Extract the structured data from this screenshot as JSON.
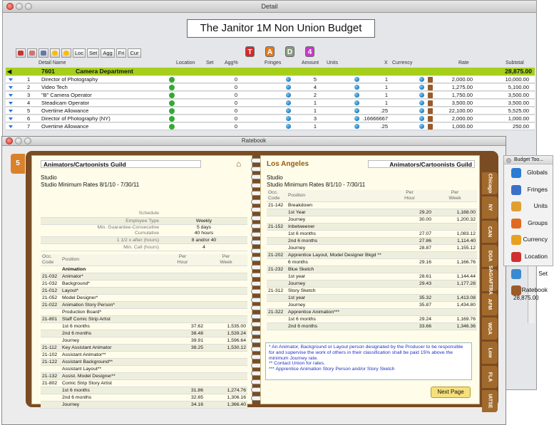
{
  "detail": {
    "window_title": "Detail",
    "budget_title": "The Janitor 1M Non Union Budget",
    "toolbar": [
      "Loc",
      "Set",
      "Agg",
      "Fri",
      "Cur"
    ],
    "letter_icons": [
      {
        "l": "T",
        "c": "#d62a2a"
      },
      {
        "l": "A",
        "c": "#e47b22"
      },
      {
        "l": "D",
        "c": "#8a9a83"
      },
      {
        "l": "4",
        "c": "#c83ac9"
      }
    ],
    "columns": {
      "detail_name": "Detail Name",
      "location": "Location",
      "set": "Set",
      "agg": "Agg%",
      "fringes": "Fringes",
      "amount": "Amount",
      "units": "Units",
      "x": "X",
      "currency": "Currency",
      "rate": "Rate",
      "subtotal": "Subtotal"
    },
    "dept": {
      "code": "7601",
      "name": "Camera Department",
      "subtotal": "28,875.00"
    },
    "rows": [
      {
        "n": "1",
        "name": "Director of Photography",
        "agg": "0",
        "amount": "5",
        "x": "1",
        "rate": "2,000.00",
        "sub": "10,000.00"
      },
      {
        "n": "2",
        "name": "Video Tech",
        "agg": "0",
        "amount": "4",
        "x": "1",
        "rate": "1,275.00",
        "sub": "5,100.00"
      },
      {
        "n": "3",
        "name": "\"B\" Camera Operator",
        "agg": "0",
        "amount": "2",
        "x": "1",
        "rate": "1,750.00",
        "sub": "3,500.00"
      },
      {
        "n": "4",
        "name": "Steadicam Operator",
        "agg": "0",
        "amount": "1",
        "x": "1",
        "rate": "3,500.00",
        "sub": "3,500.00"
      },
      {
        "n": "5",
        "name": "Overtime Allowance",
        "agg": "0",
        "amount": "1",
        "x": ".25",
        "rate": "22,100.00",
        "sub": "5,525.00"
      },
      {
        "n": "6",
        "name": "Director of Photography (NY)",
        "agg": "0",
        "amount": "3",
        "x": ".16666667",
        "rate": "2,000.00",
        "sub": "1,000.00"
      },
      {
        "n": "7",
        "name": "Overtime Allowance",
        "agg": "0",
        "amount": "1",
        "x": ".25",
        "rate": "1,000.00",
        "sub": "250.00"
      }
    ],
    "bottom_total": "28,875.00"
  },
  "ratebook": {
    "window_title": "Ratebook",
    "side_tab": "5",
    "left": {
      "guild": "Animators/Cartoonists Guild",
      "studio": "Studio",
      "rates_title": "Studio Minimum Rates 8/1/10 - 7/30/11",
      "info": [
        {
          "k": "Schedule",
          "v": ""
        },
        {
          "k": "Employee Type",
          "v": "Weekly"
        },
        {
          "k": "Min. Guarantee-Consecutive\nCumulative",
          "v": "5 days\n40 hours"
        },
        {
          "k": "1 1/2 x after (hours)",
          "v": "8 and/or 40"
        },
        {
          "k": "Min. Call (hours)",
          "v": "4"
        }
      ],
      "hdr": {
        "occ": "Occ.\nCode",
        "pos": "Position",
        "hour": "Per\nHour",
        "week": "Per\nWeek"
      },
      "rows": [
        [
          "",
          "Animation",
          "",
          ""
        ],
        [
          "21-032",
          "Animator*",
          "",
          ""
        ],
        [
          "21-032",
          "Background*",
          "",
          ""
        ],
        [
          "21-012",
          "Layout*",
          "",
          ""
        ],
        [
          "21-052",
          "Model Designer*",
          "",
          ""
        ],
        [
          "21-022",
          "Animation Story Person*",
          "",
          ""
        ],
        [
          "",
          "Production Board*",
          "",
          ""
        ],
        [
          "21-801",
          "Staff Comic Strip Artist",
          "",
          ""
        ],
        [
          "",
          "1st 6 months",
          "37.62",
          "1,535.00"
        ],
        [
          "",
          "2nd 6 months",
          "38.48",
          "1,539.24"
        ],
        [
          "",
          "Journey",
          "39.91",
          "1,596.64"
        ],
        [
          "21-112",
          "Key Assistant Animator",
          "38.25",
          "1,530.12"
        ],
        [
          "21-102",
          "Assistant Animator**",
          "",
          ""
        ],
        [
          "21-122",
          "Assistant Background**",
          "",
          ""
        ],
        [
          "",
          "Assistant Layout**",
          "",
          ""
        ],
        [
          "21-132",
          "Assist. Model Designer**",
          "",
          ""
        ],
        [
          "21-802",
          "Comic Strip Story Artist",
          "",
          ""
        ],
        [
          "",
          "1st 6 months",
          "31.86",
          "1,274.76"
        ],
        [
          "",
          "2nd 6 months",
          "32.65",
          "1,306.16"
        ],
        [
          "",
          "Journey",
          "34.16",
          "1,366.40"
        ]
      ]
    },
    "right": {
      "city": "Los Angeles",
      "guild": "Animators/Cartoonists Guild",
      "studio": "Studio",
      "rates_title": "Studio Minimum Rates 8/1/10 - 7/30/11",
      "hdr": {
        "occ": "Occ.\nCode",
        "pos": "Position",
        "hour": "Per\nHour",
        "week": "Per\nWeek"
      },
      "rows": [
        [
          "21-142",
          "Breakdown",
          "",
          ""
        ],
        [
          "",
          "1st Year",
          "29.20",
          "1,168.00"
        ],
        [
          "",
          "Journey",
          "30.00",
          "1,200.32"
        ],
        [
          "21-152",
          "Inbetweener",
          "",
          ""
        ],
        [
          "",
          "1st 6 months",
          "27.07",
          "1,083.12"
        ],
        [
          "",
          "2nd 6 months",
          "27.86",
          "1,114.40"
        ],
        [
          "",
          "Journey",
          "28.87",
          "1,155.12"
        ],
        [
          "21-202",
          "Apprentice Layout, Model Designer Bkgd **",
          "",
          ""
        ],
        [
          "",
          "6 months",
          "29.16",
          "1,166.76"
        ],
        [
          "21-232",
          "Blue Sketch",
          "",
          ""
        ],
        [
          "",
          "1st year",
          "28.61",
          "1,144.44"
        ],
        [
          "",
          "Journey",
          "29.43",
          "1,177.28"
        ],
        [
          "21-312",
          "Story Sketch",
          "",
          ""
        ],
        [
          "",
          "1st year",
          "35.32",
          "1,413.08"
        ],
        [
          "",
          "Journey",
          "35.87",
          "1,434.80"
        ],
        [
          "21-322",
          "Apprentice Animation***",
          "",
          ""
        ],
        [
          "",
          "1st 6 months",
          "29.24",
          "1,169.76"
        ],
        [
          "",
          "2nd 6 months",
          "33.66",
          "1,346.36"
        ]
      ],
      "notes": [
        "* An Animator, Background or Layout person designated by the Producer to be responsible for and supervise the work of others in their classification shall be paid 15% above the minimum Journey rate.",
        "** Contact Union for rates.",
        "*** Apprentice Animation Story Person and/or Story Sketch"
      ],
      "next": "Next Page"
    },
    "tabs": [
      "Chicago",
      "NY",
      "CAN",
      "DGA",
      "SAG/AFTRA",
      "AFM",
      "WGA",
      "Low",
      "FLA",
      "IATSE"
    ]
  },
  "panel": {
    "title": "Budget Too...",
    "items": [
      {
        "l": "Globals",
        "c": "#2a7bd6"
      },
      {
        "l": "Fringes",
        "c": "#3a70c8"
      },
      {
        "l": "Units",
        "c": "#e0a030"
      },
      {
        "l": "Groups",
        "c": "#e06a20"
      },
      {
        "l": "Currency",
        "c": "#e8a020"
      },
      {
        "l": "Location",
        "c": "#d03030"
      },
      {
        "l": "Set",
        "c": "#3a8ad0"
      },
      {
        "l": "Ratebook",
        "c": "#9a5a2a"
      }
    ]
  }
}
